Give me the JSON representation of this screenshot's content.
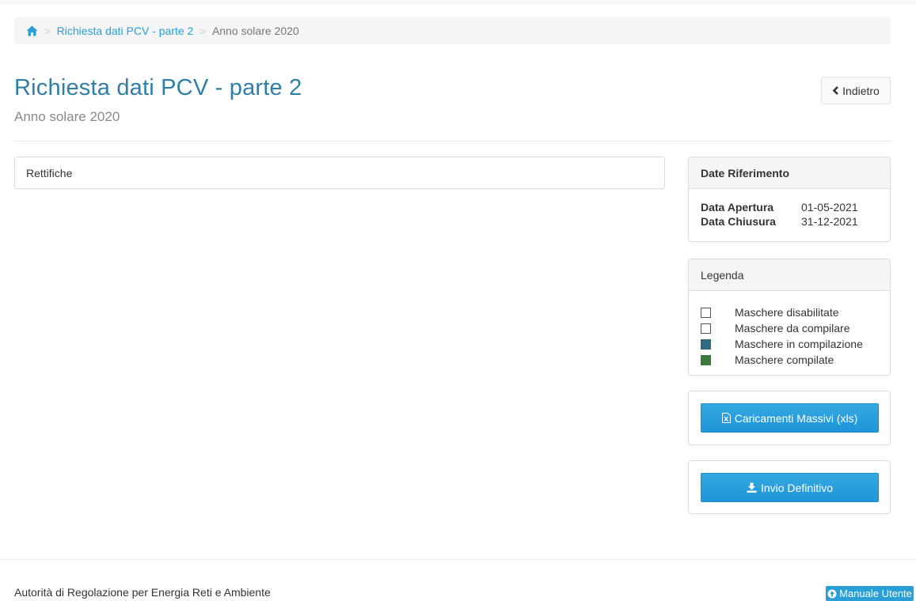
{
  "breadcrumb": {
    "home_icon": "home-icon",
    "separator": ">",
    "link_label": "Richiesta dati PCV - parte 2",
    "current_label": "Anno solare 2020"
  },
  "header": {
    "title": "Richiesta dati PCV - parte 2",
    "subtitle": "Anno solare 2020",
    "back_label": "Indietro",
    "back_icon": "chevron-left-icon"
  },
  "main": {
    "rettifiche_label": "Rettifiche"
  },
  "dates": {
    "heading": "Date Riferimento",
    "rows": [
      {
        "label": "Data Apertura",
        "value": "01-05-2021"
      },
      {
        "label": "Data Chiusura",
        "value": "31-12-2021"
      }
    ]
  },
  "legend": {
    "heading": "Legenda",
    "items": [
      {
        "label": "Maschere disabilitate",
        "color": "#ffffff"
      },
      {
        "label": "Maschere da compilare",
        "color": "#ffffff"
      },
      {
        "label": "Maschere in compilazione",
        "color": "#2e6a84"
      },
      {
        "label": "Maschere compilate",
        "color": "#3a7a3e"
      }
    ]
  },
  "actions": {
    "massive_label": "Caricamenti Massivi (xls)",
    "massive_icon": "excel-file-icon",
    "send_label": "Invio Definitivo",
    "send_icon": "download-icon"
  },
  "footer": {
    "authority": "Autorità di Regolazione per Energia Reti e Ambiente",
    "manual_label": "Manuale Utente",
    "manual_icon": "arrow-circle-up-icon"
  },
  "colors": {
    "accent": "#2a9fd6",
    "title": "#2e7fa7"
  }
}
